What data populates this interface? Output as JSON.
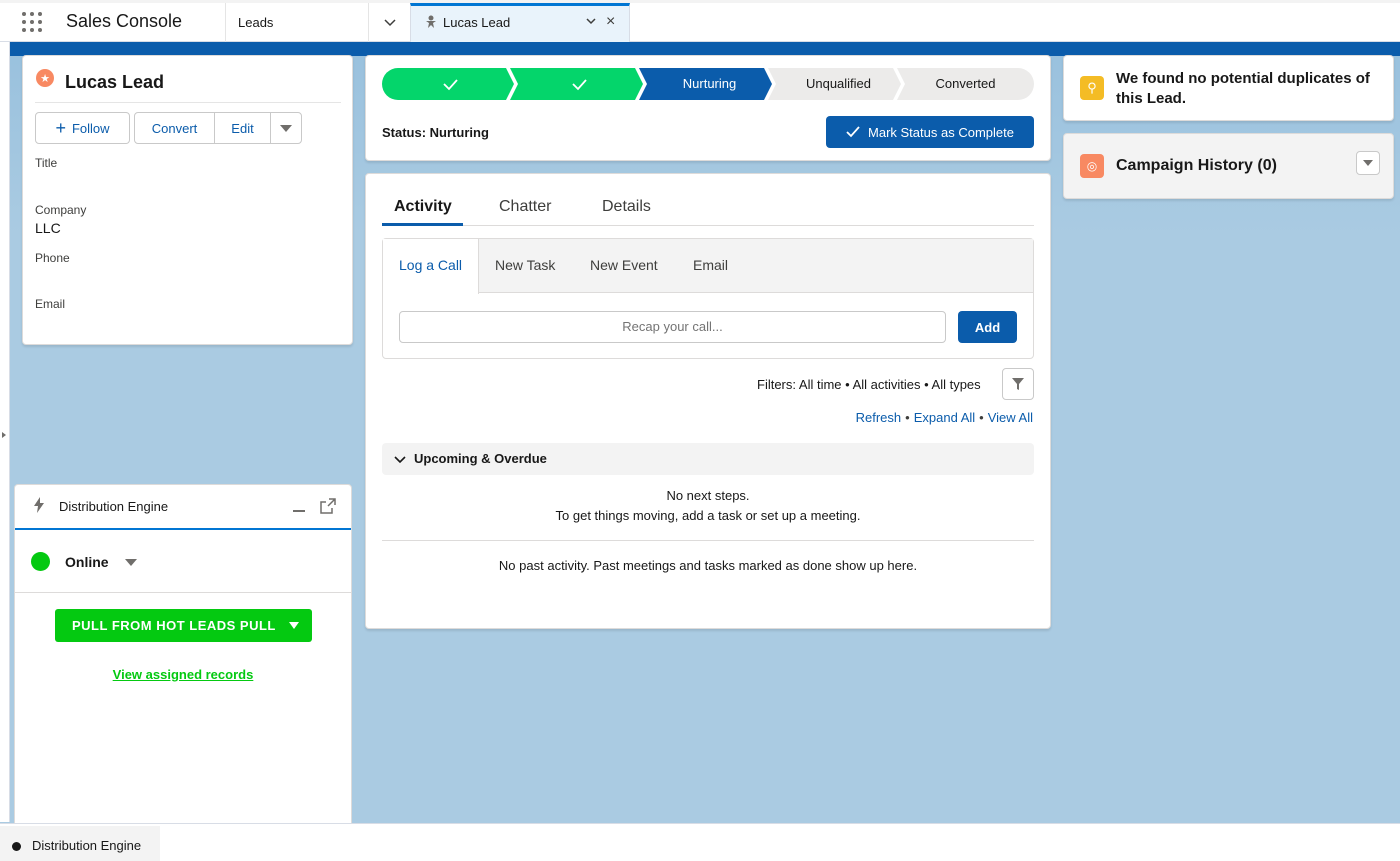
{
  "header": {
    "app_name": "Sales Console",
    "nav_item": "Leads",
    "active_tab": "Lucas Lead"
  },
  "lead": {
    "name": "Lucas Lead",
    "buttons": {
      "follow": "Follow",
      "convert": "Convert",
      "edit": "Edit"
    },
    "fields": [
      {
        "label": "Title",
        "value": ""
      },
      {
        "label": "Company",
        "value": "LLC"
      },
      {
        "label": "Phone",
        "value": ""
      },
      {
        "label": "Email",
        "value": ""
      }
    ]
  },
  "path": {
    "stages": [
      {
        "label": "",
        "state": "complete"
      },
      {
        "label": "",
        "state": "complete"
      },
      {
        "label": "Nurturing",
        "state": "current"
      },
      {
        "label": "Unqualified",
        "state": "incomplete"
      },
      {
        "label": "Converted",
        "state": "incomplete"
      }
    ],
    "status_text": "Status: Nurturing",
    "mark_button": "Mark Status as Complete"
  },
  "activity": {
    "tabs": [
      "Activity",
      "Chatter",
      "Details"
    ],
    "publisher_tabs": [
      "Log a Call",
      "New Task",
      "New Event",
      "Email"
    ],
    "recap_placeholder": "Recap your call...",
    "add_button": "Add",
    "filters": "Filters: All time • All activities • All types",
    "links": {
      "refresh": "Refresh",
      "expand_all": "Expand All",
      "view_all": "View All"
    },
    "upcoming_label": "Upcoming & Overdue",
    "no_next_1": "No next steps.",
    "no_next_2": "To get things moving, add a task or set up a meeting.",
    "no_past": "No past activity. Past meetings and tasks marked as done show up here."
  },
  "duplicates": {
    "text": "We found no potential duplicates of this Lead."
  },
  "campaign": {
    "title": "Campaign History (0)"
  },
  "distribution": {
    "title": "Distribution Engine",
    "status": "Online",
    "pull_button": "PULL FROM HOT LEADS PULL",
    "view_link": "View assigned records"
  },
  "utility_bar": {
    "item": "Distribution Engine"
  },
  "colors": {
    "brand_blue": "#0b5cab",
    "path_complete": "#04d56b",
    "path_incomplete": "#ecebea",
    "online_green": "#04c911",
    "background": "#aacbe2"
  }
}
